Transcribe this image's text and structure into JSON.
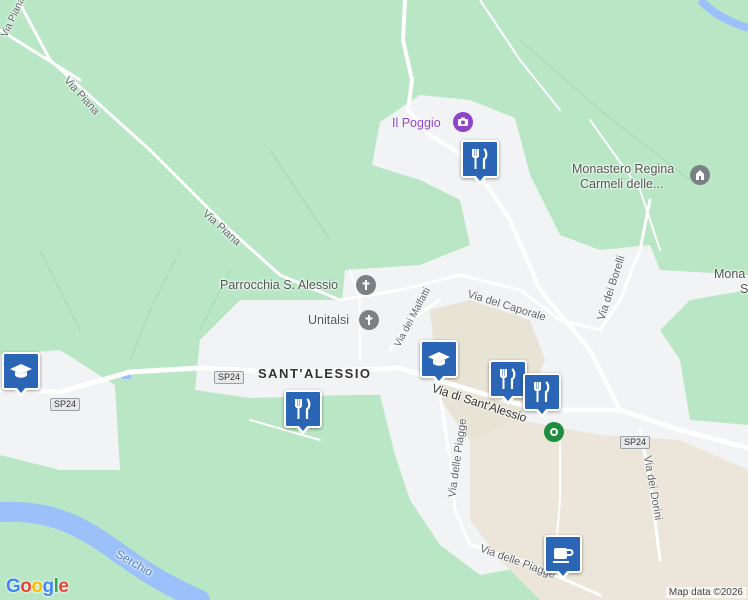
{
  "map": {
    "places": {
      "il_poggio": "Il Poggio",
      "monastero_line1": "Monastero Regina",
      "monastero_line2": "Carmeli delle...",
      "mona_partial_1": "Mona",
      "mona_partial_2": "S",
      "parrocchia": "Parrocchia S. Alessio",
      "unitalsi": "Unitalsi",
      "town": "SANT'ALESSIO"
    },
    "roads": {
      "via_piana_1": "Via Piana",
      "via_piana_2": "Via Piana",
      "via_piana_top": "Via Piana",
      "via_del_caporale": "Via del Caporale",
      "via_del_malfatti": "Via dei Malfatti",
      "via_dei_borelli": "Via dei Borelli",
      "via_di_sant_alessio": "Via di Sant'Alessio",
      "via_delle_piagge_1": "Via delle Piagge",
      "via_delle_piagge_2": "Via delle Piagge",
      "via_dei_dorini": "Via dei Dorini",
      "river": "Serchio"
    },
    "shields": [
      "SP24",
      "SP24",
      "SP24"
    ],
    "pins": [
      {
        "type": "restaurant",
        "icon": "fork-knife-icon"
      },
      {
        "type": "restaurant",
        "icon": "fork-knife-icon"
      },
      {
        "type": "restaurant",
        "icon": "fork-knife-icon"
      },
      {
        "type": "restaurant",
        "icon": "fork-knife-icon"
      },
      {
        "type": "school",
        "icon": "graduation-cap-icon"
      },
      {
        "type": "school",
        "icon": "graduation-cap-icon"
      },
      {
        "type": "cafe",
        "icon": "coffee-cup-icon"
      }
    ],
    "attribution": {
      "logo": "Google",
      "map_data": "Map data ©2026"
    },
    "colors": {
      "park": "#b9e7c6",
      "urban": "#f1f3f4",
      "rural": "#ebe6d9",
      "water": "#9cc0f9",
      "road": "#ffffff",
      "pin": "#2a66b5",
      "poi_purple": "#8e44c9",
      "poi_gray": "#7b8085",
      "poi_green": "#1e8e3e"
    }
  }
}
